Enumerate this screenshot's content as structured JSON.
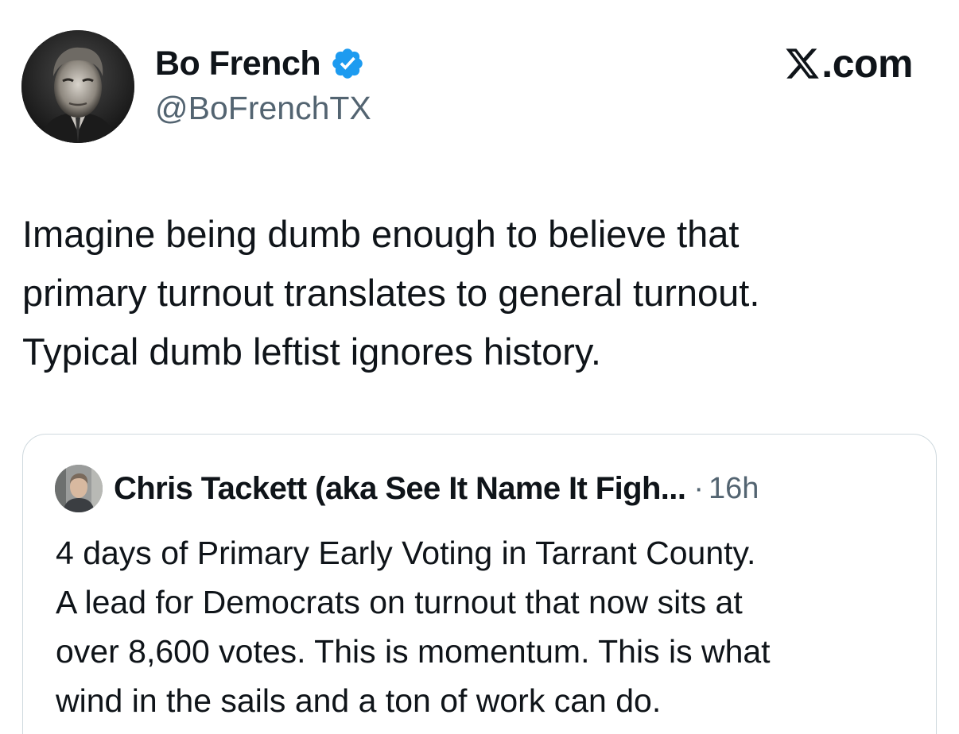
{
  "author": {
    "display_name": "Bo French",
    "handle": "@BoFrenchTX",
    "avatar_icon": "profile-photo",
    "verified_icon": "verified-badge-icon",
    "verified_color": "#1d9bf0"
  },
  "site": {
    "logo_icon": "x-logo-icon",
    "suffix": ".com"
  },
  "tweet": {
    "lines": [
      "Imagine being dumb enough to believe that",
      "primary turnout translates to general turnout.",
      "Typical dumb leftist ignores history."
    ]
  },
  "quoted_tweet": {
    "author_name": "Chris Tackett (aka See It Name It Figh...",
    "separator": "·",
    "time": "16h",
    "avatar_icon": "profile-photo",
    "lines": [
      "4 days of Primary Early Voting in Tarrant County.",
      "A lead for Democrats on turnout that now sits at",
      "over 8,600 votes. This is momentum. This is what",
      "wind in the sails and a ton of work can do."
    ]
  },
  "colors": {
    "text_primary": "#0f1419",
    "text_secondary": "#536471",
    "border": "#cfd9de",
    "accent": "#1d9bf0"
  }
}
